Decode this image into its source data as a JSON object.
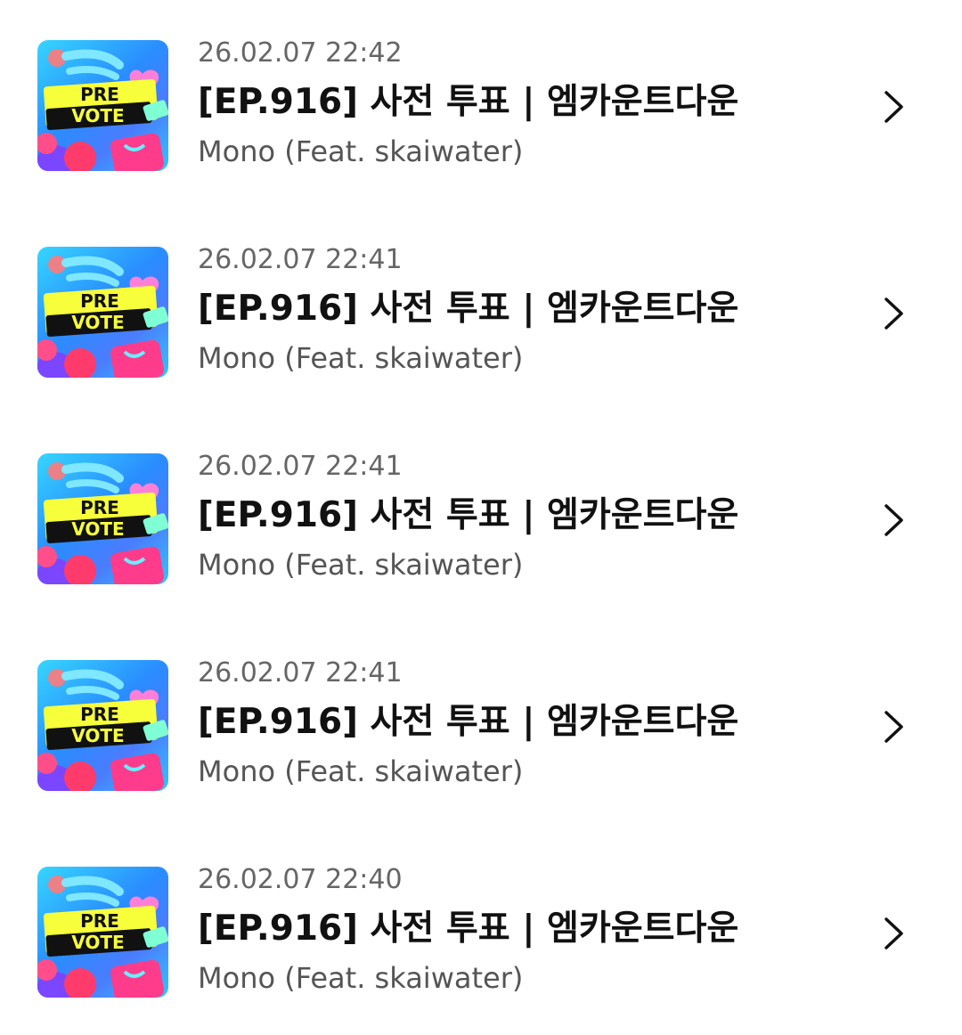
{
  "items": [
    {
      "datetime": "26.02.07 22:42",
      "title": "[EP.916] 사전 투표 | 엠카운트다운",
      "artist": "Mono (Feat. skaiwater)",
      "thumb": {
        "line1": "PRE",
        "line2": "VOTE"
      }
    },
    {
      "datetime": "26.02.07 22:41",
      "title": "[EP.916] 사전 투표 | 엠카운트다운",
      "artist": "Mono (Feat. skaiwater)",
      "thumb": {
        "line1": "PRE",
        "line2": "VOTE"
      }
    },
    {
      "datetime": "26.02.07 22:41",
      "title": "[EP.916] 사전 투표 | 엠카운트다운",
      "artist": "Mono (Feat. skaiwater)",
      "thumb": {
        "line1": "PRE",
        "line2": "VOTE"
      }
    },
    {
      "datetime": "26.02.07 22:41",
      "title": "[EP.916] 사전 투표 | 엠카운트다운",
      "artist": "Mono (Feat. skaiwater)",
      "thumb": {
        "line1": "PRE",
        "line2": "VOTE"
      }
    },
    {
      "datetime": "26.02.07 22:40",
      "title": "[EP.916] 사전 투표 | 엠카운트다운",
      "artist": "Mono (Feat. skaiwater)",
      "thumb": {
        "line1": "PRE",
        "line2": "VOTE"
      }
    }
  ],
  "icons": {
    "row_action": "chevron-right-icon"
  },
  "colors": {
    "date_text": "#666666",
    "title_text": "#111111",
    "artist_text": "#555555",
    "thumb_banner": "#f7ff3a",
    "thumb_band": "#111111",
    "thumb_heart": "#ff7fd8"
  }
}
